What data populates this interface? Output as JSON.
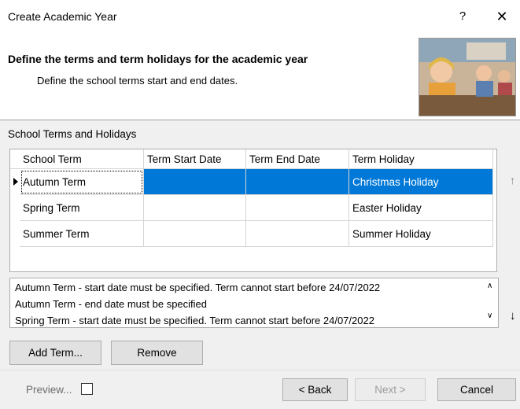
{
  "window": {
    "title": "Create Academic Year",
    "help_label": "?",
    "close_label": "✕"
  },
  "banner": {
    "title": "Define the terms and term holidays for the academic year",
    "subtitle": "Define the school terms start and end dates."
  },
  "section_label": "School Terms and Holidays",
  "grid": {
    "headers": [
      "School Term",
      "Term Start Date",
      "Term End Date",
      "Term Holiday"
    ],
    "rows": [
      {
        "term": "Autumn Term",
        "start": "",
        "end": "",
        "holiday": "Christmas Holiday"
      },
      {
        "term": "Spring Term",
        "start": "",
        "end": "",
        "holiday": "Easter Holiday"
      },
      {
        "term": "Summer Term",
        "start": "",
        "end": "",
        "holiday": "Summer Holiday"
      }
    ]
  },
  "side_buttons": {
    "up_icon": "↑",
    "down_icon": "↓"
  },
  "messages": [
    "Autumn Term - start date must be specified. Term cannot start before 24/07/2022",
    "Autumn Term - end date must be specified",
    "Spring Term - start date must be specified. Term cannot start before 24/07/2022"
  ],
  "buttons": {
    "add_term": "Add Term...",
    "remove": "Remove",
    "preview": "Preview...",
    "back": "< Back",
    "next": "Next >",
    "cancel": "Cancel"
  },
  "colors": {
    "selection": "#0078d7",
    "window_bg": "#f0f0f0"
  }
}
